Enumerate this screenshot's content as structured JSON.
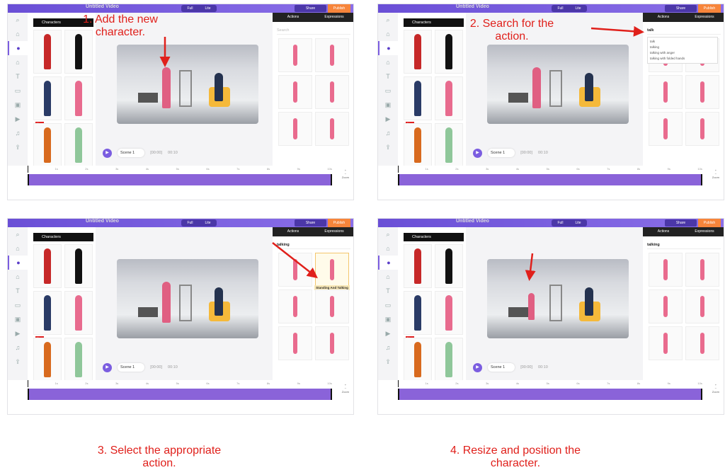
{
  "app": {
    "title": "Untitled Video",
    "mode_toggle": [
      "Full",
      "Lite"
    ],
    "share_label": "Share",
    "publish_label": "Publish",
    "characters_tab": "Characters",
    "actions_tab": "Actions",
    "expressions_tab": "Expressions",
    "search_placeholder": "Search",
    "new_badge": "New",
    "scene_label": "Scene 1",
    "time_start": "[00:00]",
    "time_end": "00:10",
    "timeline_ticks": [
      "1s",
      "2s",
      "3s",
      "4s",
      "5s",
      "6s",
      "7s",
      "8s",
      "9s",
      "10s"
    ],
    "zoom_label": "Zoom",
    "rail_icons": [
      "search-icon",
      "scene-icon",
      "character-icon",
      "prop-icon",
      "text-icon",
      "caption-icon",
      "image-icon",
      "video-icon",
      "music-icon",
      "upload-icon"
    ]
  },
  "colors": {
    "accent": "#7b5de0",
    "publish": "#f7853b",
    "caption": "#e0201b",
    "new_badge": "#e02020"
  },
  "panels": [
    {
      "caption": "1. Add the new character.",
      "search_value": "",
      "suggestions": [],
      "tooltip": ""
    },
    {
      "caption": "2. Search for the action.",
      "search_value": "talk",
      "suggestions": [
        "talk",
        "talking",
        "talking with anger",
        "talking with folded hands"
      ],
      "tooltip": ""
    },
    {
      "caption": "3. Select the appropriate action.",
      "search_value": "talking",
      "suggestions": [],
      "tooltip": "Standing And Talking"
    },
    {
      "caption": "4. Resize and position the character.",
      "search_value": "talking",
      "suggestions": [],
      "tooltip": ""
    }
  ]
}
